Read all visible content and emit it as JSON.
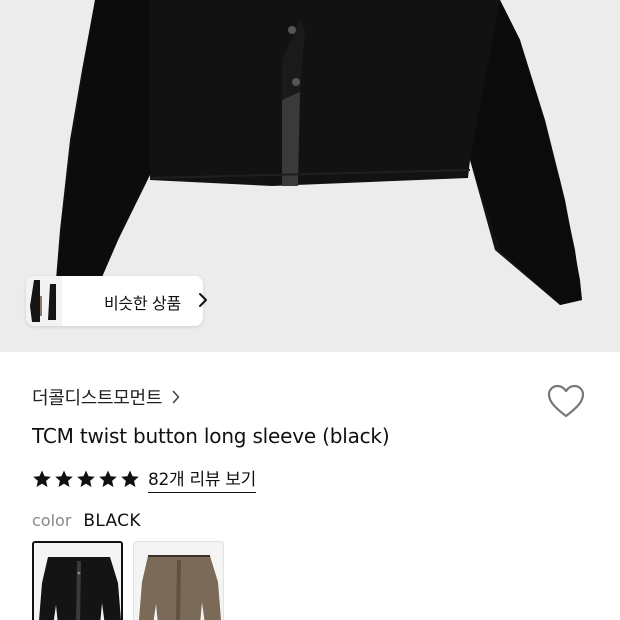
{
  "product": {
    "similar_label": "비슷한 상품",
    "brand": "더콜디스트모먼트",
    "title": "TCM twist button long sleeve (black)",
    "rating_stars": 5,
    "review_link": "82개 리뷰 보기",
    "color_label": "color",
    "color_value": "BLACK"
  },
  "icons": {
    "similar_chevron": "chevron-right-icon",
    "brand_chevron": "chevron-right-icon",
    "wishlist": "heart-outline-icon",
    "star": "star-icon"
  },
  "colors": {
    "hero_background": "#ececec",
    "jacket": "#111111",
    "swatch_khaki": "#7b6a58"
  }
}
